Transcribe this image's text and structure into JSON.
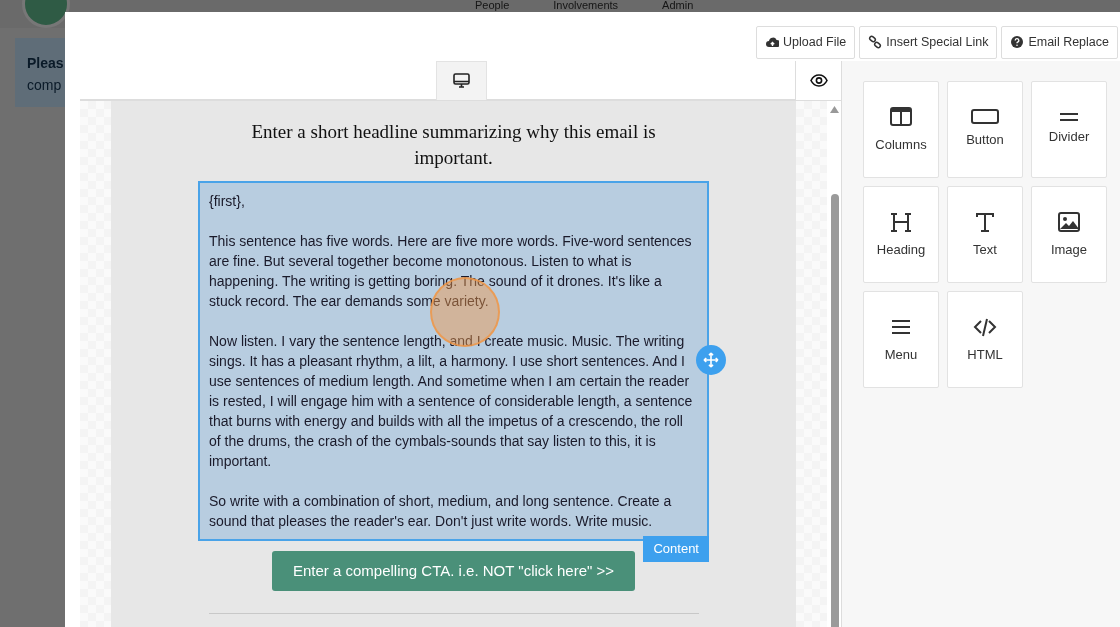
{
  "background_page": {
    "nav": [
      "People",
      "Involvements",
      "Admin"
    ],
    "alert": {
      "title": "Pleas",
      "text": "comp"
    }
  },
  "toolbar": [
    {
      "kind": "upload",
      "label": "Upload File"
    },
    {
      "kind": "link",
      "label": "Insert Special Link"
    },
    {
      "kind": "help",
      "label": "Email Replace"
    }
  ],
  "device_tabs": [
    {
      "kind": "desktop",
      "selected": true
    }
  ],
  "email": {
    "headline": "Enter a short headline summarizing why this email is important.",
    "content": [
      "{first},",
      "This sentence has five words. Here are five more words. Five-word sentences are fine. But several together become monotonous. Listen to what is happening. The writing is getting boring. The sound of it drones. It's like a stuck record. The ear demands some variety.",
      "Now listen. I vary the sentence length, and I create music. Music. The writing sings. It has a pleasant rhythm, a lilt, a harmony. I use short sentences. And I use sentences of medium length. And sometime when I am certain the reader is rested, I will engage him with a sentence of considerable length, a sentence that burns with energy and builds with all the impetus of a crescendo, the roll of the drums, the crash of the cymbals-sounds that say listen to this, it is important.",
      "So write with a combination of short, medium, and long sentence. Create a sound that pleases the reader's ear. Don't just write words. Write music."
    ],
    "content_label": "Content",
    "cta": "Enter a compelling CTA. i.e. NOT \"click here\" >>"
  },
  "blocks": [
    {
      "kind": "columns",
      "label": "Columns"
    },
    {
      "kind": "button",
      "label": "Button"
    },
    {
      "kind": "divider",
      "label": "Divider"
    },
    {
      "kind": "heading",
      "label": "Heading"
    },
    {
      "kind": "text",
      "label": "Text"
    },
    {
      "kind": "image",
      "label": "Image"
    },
    {
      "kind": "menu",
      "label": "Menu"
    },
    {
      "kind": "html",
      "label": "HTML"
    }
  ]
}
